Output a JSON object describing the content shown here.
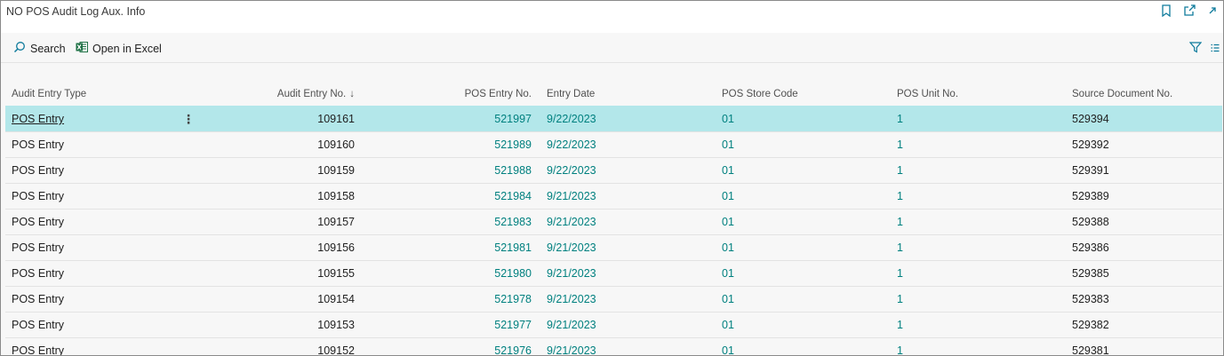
{
  "page": {
    "title": "NO POS Audit Log Aux. Info"
  },
  "actions": {
    "search": "Search",
    "excel": "Open in Excel"
  },
  "columns": {
    "audit_entry_type": "Audit Entry Type",
    "audit_entry_no": "Audit Entry No.",
    "sort_indicator": "↓",
    "pos_entry_no": "POS Entry No.",
    "entry_date": "Entry Date",
    "pos_store_code": "POS Store Code",
    "pos_unit_no": "POS Unit No.",
    "source_document_no": "Source Document No."
  },
  "row_menu_glyph": "⋮",
  "rows": [
    {
      "type": "POS Entry",
      "audit_no": "109161",
      "pos_no": "521997",
      "date": "9/22/2023",
      "store": "01",
      "unit": "1",
      "source": "529394"
    },
    {
      "type": "POS Entry",
      "audit_no": "109160",
      "pos_no": "521989",
      "date": "9/22/2023",
      "store": "01",
      "unit": "1",
      "source": "529392"
    },
    {
      "type": "POS Entry",
      "audit_no": "109159",
      "pos_no": "521988",
      "date": "9/22/2023",
      "store": "01",
      "unit": "1",
      "source": "529391"
    },
    {
      "type": "POS Entry",
      "audit_no": "109158",
      "pos_no": "521984",
      "date": "9/21/2023",
      "store": "01",
      "unit": "1",
      "source": "529389"
    },
    {
      "type": "POS Entry",
      "audit_no": "109157",
      "pos_no": "521983",
      "date": "9/21/2023",
      "store": "01",
      "unit": "1",
      "source": "529388"
    },
    {
      "type": "POS Entry",
      "audit_no": "109156",
      "pos_no": "521981",
      "date": "9/21/2023",
      "store": "01",
      "unit": "1",
      "source": "529386"
    },
    {
      "type": "POS Entry",
      "audit_no": "109155",
      "pos_no": "521980",
      "date": "9/21/2023",
      "store": "01",
      "unit": "1",
      "source": "529385"
    },
    {
      "type": "POS Entry",
      "audit_no": "109154",
      "pos_no": "521978",
      "date": "9/21/2023",
      "store": "01",
      "unit": "1",
      "source": "529383"
    },
    {
      "type": "POS Entry",
      "audit_no": "109153",
      "pos_no": "521977",
      "date": "9/21/2023",
      "store": "01",
      "unit": "1",
      "source": "529382"
    },
    {
      "type": "POS Entry",
      "audit_no": "109152",
      "pos_no": "521976",
      "date": "9/21/2023",
      "store": "01",
      "unit": "1",
      "source": "529381"
    }
  ],
  "colors": {
    "accent": "#00807f",
    "selected_row": "#b3e7ea",
    "excel_green": "#1e7145"
  }
}
